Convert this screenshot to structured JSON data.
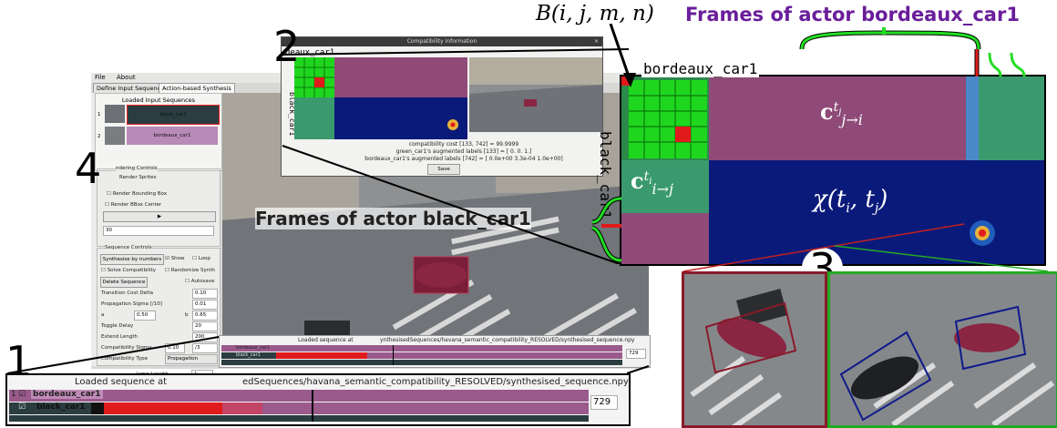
{
  "callouts": {
    "n1": "1",
    "n2": "2",
    "n3": "3",
    "n4": "4"
  },
  "labels": {
    "b_ijmn": "B(i, j, m, n)",
    "frames_bordeaux": "Frames of actor bordeaux_car1",
    "frames_black": "Frames of actor black_car1",
    "bordeaux_title": "bordeaux_car1",
    "black_title": "black_car1",
    "c_ji": "c",
    "c_ji_sup": "t",
    "c_ji_supsub": "j",
    "c_ji_sub": "j→i",
    "c_ij": "c",
    "c_ij_sup": "t",
    "c_ij_supsub": "i",
    "c_ij_sub": "i→j",
    "chi": "χ(t",
    "chi_i": "i",
    "chi_mid": ", t",
    "chi_j": "j",
    "chi_end": ")"
  },
  "menu": {
    "file": "File",
    "about": "About"
  },
  "tabs": {
    "define": "Define Input Sequences",
    "action": "Action-based Synthesis"
  },
  "sequences": {
    "header": "Loaded Input Sequences",
    "items": [
      {
        "index": "1",
        "name": "black_car1"
      },
      {
        "index": "2",
        "name": "bordeaux_car1"
      }
    ]
  },
  "rendering": {
    "group": "ndering Controls",
    "render_sprites": "Render Sprites",
    "render_bbox": "Render Bounding Box",
    "render_bbox_center": "Render BBox Center",
    "play": "▶",
    "frame_value": "30"
  },
  "sequence_controls": {
    "group": "Sequence Controls",
    "synth_by_numbers": "Synthesise by numbers",
    "show": "Show",
    "loop": "Loop",
    "solve_compat": "Solve Compatibility",
    "randomize": "Randomize Synth",
    "delete_seq": "Delete Sequence",
    "autosave": "Autosave",
    "transition_cost_delta": "Transition Cost Delta",
    "transition_cost_value": "0.10",
    "prop_sigma": "Propagation Sigma [/10]",
    "prop_sigma_value": "0.01",
    "a_label": "a",
    "a_value": "0.50",
    "b_label": "b",
    "b_value": "0.65",
    "toggle_delay": "Toggle Delay",
    "toggle_delay_value": "20",
    "extend_length": "Extend Length",
    "extend_length_value": "200",
    "compat_sigma": "Compatibility Sigma",
    "compat_sigma_value": "0.10",
    "compat_sigma_value2": "/3",
    "compat_type": "Compatibility Type",
    "compat_type_value": "Propagation",
    "jump_length": "Jump Length",
    "jump_length_value": "1"
  },
  "compat_window": {
    "title": "Compatibility Information",
    "close": "×",
    "top_label": "deaux_car1",
    "side_label": "black_car1",
    "line1": "compatibility cost [133, 742] = 99.9999",
    "line2": "green_car1's augmented labels [133] = [ 0.  0.  1.]",
    "line3": "bordeaux_car1's augmented labels [742] = [ 0.0e+00  3.3e-04  1.0e+00]",
    "save": "Save"
  },
  "zoom": {
    "top_label": "bordeaux_car1",
    "side_label": "black_car1"
  },
  "timeline_small": {
    "loaded_prefix": "Loaded sequence at",
    "loaded_suffix": "ynthesisedSequences/havana_semantic_compatibility_RESOLVED/synthesised_sequence.npy",
    "row1": "bordeaux_car1",
    "row2": "black_car1",
    "value": "729"
  },
  "timeline_big": {
    "loaded_prefix": "Loaded sequence at",
    "loaded_suffix": "edSequences/havana_semantic_compatibility_RESOLVED/synthesised_sequence.npy",
    "row1_index": "1",
    "row1": "bordeaux_car1",
    "row2": "black_car1",
    "value": "729"
  },
  "colors": {
    "purple": "#9a5a8c",
    "dark_teal": "#2b3d40",
    "green": "#22dd22",
    "red": "#e11b1b",
    "navy": "#0a1a7a",
    "title_purple": "#6a1e9a",
    "magenta": "#8f4a78",
    "teal_green": "#3a9a6e"
  }
}
